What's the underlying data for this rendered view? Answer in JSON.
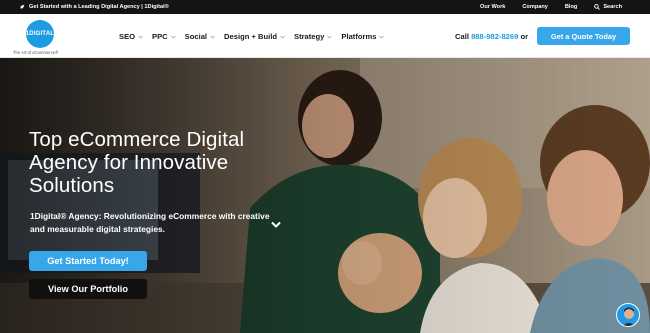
{
  "topbar": {
    "promo": "Get Started with a Leading Digital Agency | 1Digital®",
    "links": [
      "Our Work",
      "Company",
      "Blog"
    ],
    "search_label": "Search"
  },
  "header": {
    "logo_text": "1DIGITAL",
    "tagline": "The Art of eCommerce®",
    "nav": [
      "SEO",
      "PPC",
      "Social",
      "Design + Build",
      "Strategy",
      "Platforms"
    ],
    "call_prefix": "Call",
    "phone": "888-982-8269",
    "call_suffix": "or",
    "quote_button": "Get a Quote Today"
  },
  "hero": {
    "title": "Top eCommerce Digital Agency for Innovative Solutions",
    "subtitle": "1Digital® Agency: Revolutionizing eCommerce with creative and measurable digital strategies.",
    "primary_button": "Get Started Today!",
    "secondary_button": "View Our Portfolio"
  },
  "colors": {
    "accent": "#38a6ea",
    "brand": "#1e9be3",
    "topbar": "#141414",
    "dark_button": "#101010"
  }
}
